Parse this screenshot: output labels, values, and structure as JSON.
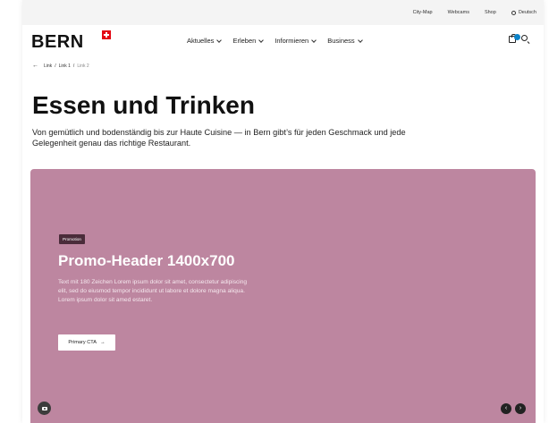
{
  "topbar": {
    "links": [
      "City-Map",
      "Webcams",
      "Shop"
    ],
    "language": "Deutsch"
  },
  "brand": {
    "logo": "BERN",
    "flag_color": "#e30613"
  },
  "nav": {
    "items": [
      "Aktuelles",
      "Erleben",
      "Informieren",
      "Business"
    ]
  },
  "actions": {
    "bag_icon": "shopping-bag-icon",
    "search_icon": "search-icon",
    "badge_color": "#0b83c9"
  },
  "breadcrumb": {
    "items": [
      "Link",
      "Link 1",
      "Link 2"
    ],
    "separator": "/"
  },
  "page": {
    "title": "Essen und Trinken",
    "intro": "Von gemütlich und bodenständig bis zur Haute Cuisine — in Bern gibt’s für jeden Geschmack und jede Gelegenheit genau das richtige Restaurant."
  },
  "hero": {
    "tag": "Promotion",
    "title": "Promo-Header 1400x700",
    "text": "Text mit 180 Zeichen Lorem ipsum dolor sit amet, consectetur adipiscing elit, sed do eiusmod tempor incididunt ut labore et dolore magna aliqua. Lorem ipsum dolor sit amed estaret.",
    "cta_label": "Primary CTA",
    "cta_arrow": "→",
    "background_color": "#bd86a0",
    "camera_icon": "camera-icon",
    "prev_arrow": "‹",
    "next_arrow": "›"
  }
}
